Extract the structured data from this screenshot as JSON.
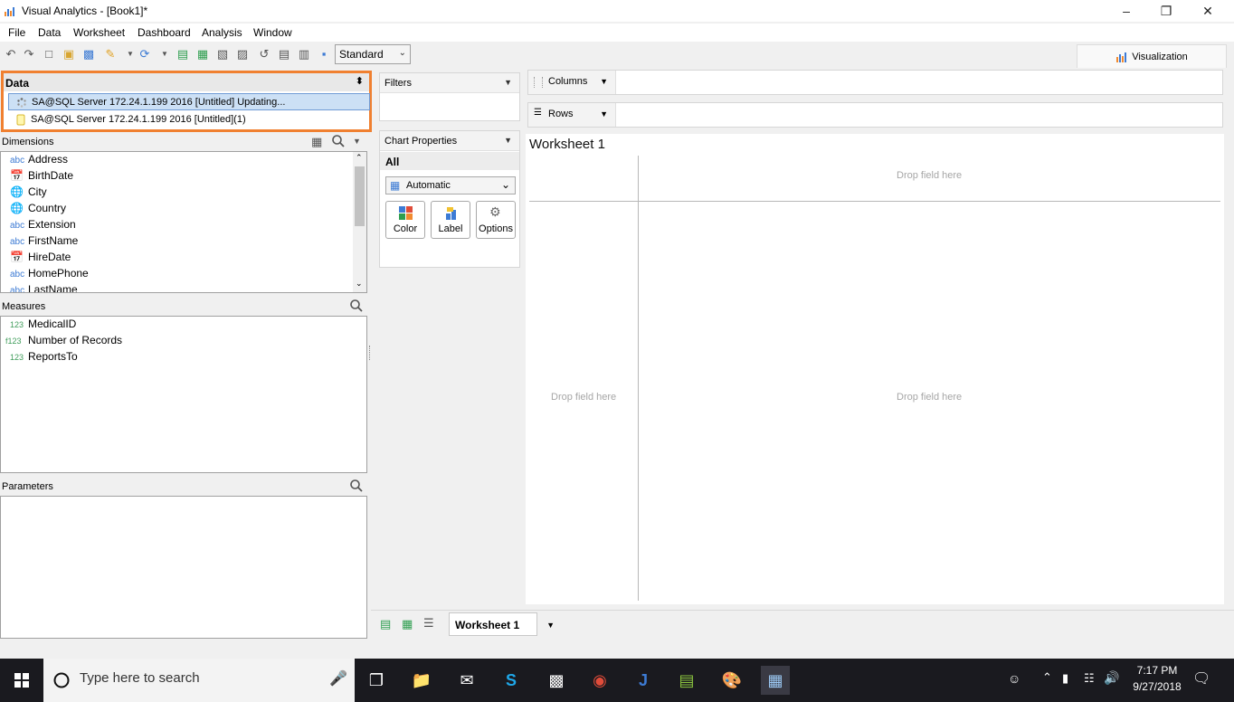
{
  "window": {
    "title": "Visual Analytics - [Book1]*"
  },
  "menu": [
    "File",
    "Data",
    "Worksheet",
    "Dashboard",
    "Analysis",
    "Window"
  ],
  "toolbar": {
    "mode_select": "Standard"
  },
  "viz_tab": "Visualization",
  "data_panel": {
    "header": "Data",
    "sources": [
      "SA@SQL Server 172.24.1.199 2016 [Untitled] Updating...",
      "SA@SQL Server 172.24.1.199 2016 [Untitled](1)"
    ]
  },
  "dimensions": {
    "header": "Dimensions",
    "items": [
      {
        "icon": "abc",
        "label": "Address"
      },
      {
        "icon": "date",
        "label": "BirthDate"
      },
      {
        "icon": "globe",
        "label": "City"
      },
      {
        "icon": "globe",
        "label": "Country"
      },
      {
        "icon": "abc",
        "label": "Extension"
      },
      {
        "icon": "abc",
        "label": "FirstName"
      },
      {
        "icon": "date",
        "label": "HireDate"
      },
      {
        "icon": "abc",
        "label": "HomePhone"
      },
      {
        "icon": "abc",
        "label": "LastName"
      }
    ]
  },
  "measures": {
    "header": "Measures",
    "items": [
      {
        "icon": "123",
        "label": "MedicalID"
      },
      {
        "icon": "f123",
        "label": "Number of Records"
      },
      {
        "icon": "123",
        "label": "ReportsTo"
      }
    ]
  },
  "parameters": {
    "header": "Parameters"
  },
  "filters": {
    "header": "Filters"
  },
  "chart_properties": {
    "header": "Chart Properties",
    "tab": "All",
    "mark_type": "Automatic",
    "buttons": [
      "Color",
      "Label",
      "Options"
    ]
  },
  "shelves": {
    "columns": "Columns",
    "rows": "Rows"
  },
  "worksheet": {
    "title": "Worksheet 1",
    "drop_text": "Drop field here"
  },
  "sheet_tab": "Worksheet 1",
  "taskbar": {
    "search_placeholder": "Type here to search",
    "time": "7:17 PM",
    "date": "9/27/2018"
  }
}
